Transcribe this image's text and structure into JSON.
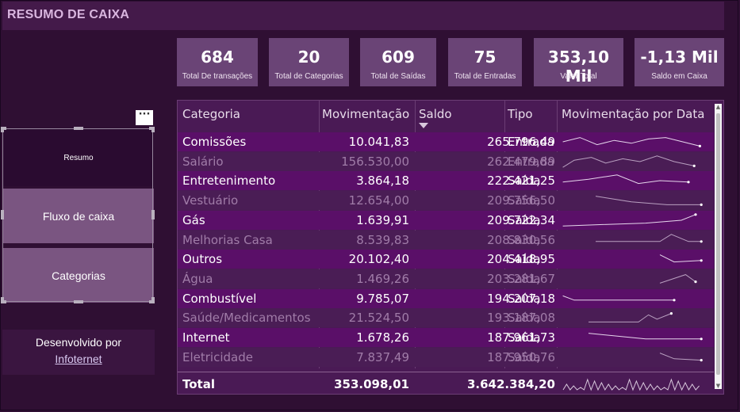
{
  "header": {
    "title": "RESUMO DE CAIXA"
  },
  "kpis": [
    {
      "value": "684",
      "label": "Total De transações"
    },
    {
      "value": "20",
      "label": "Total de Categorias"
    },
    {
      "value": "609",
      "label": "Total de Saídas"
    },
    {
      "value": "75",
      "label": "Total de Entradas"
    },
    {
      "value": "353,10 Mil",
      "label": "Valor Total"
    },
    {
      "value": "-1,13 Mil",
      "label": "Saldo em Caixa"
    }
  ],
  "nav": {
    "more_label": "···",
    "items": [
      {
        "label": "Resumo"
      },
      {
        "label": "Fluxo de caixa"
      },
      {
        "label": "Categorias"
      }
    ]
  },
  "developer": {
    "line1": "Desenvolvido por",
    "link": "Infoternet"
  },
  "table": {
    "headers": {
      "categoria": "Categoria",
      "movimentacao": "Movimentação",
      "saldo": "Saldo",
      "tipo": "Tipo",
      "por_data": "Movimentação por Data"
    },
    "rows": [
      {
        "categoria": "Comissões",
        "movimentacao": "10.041,83",
        "saldo": "265.796,49",
        "tipo": "Entrada"
      },
      {
        "categoria": "Salário",
        "movimentacao": "156.530,00",
        "saldo": "262.479,89",
        "tipo": "Entrada"
      },
      {
        "categoria": "Entretenimento",
        "movimentacao": "3.864,18",
        "saldo": "222.421,25",
        "tipo": "Saída"
      },
      {
        "categoria": "Vestuário",
        "movimentacao": "12.654,00",
        "saldo": "209.756,50",
        "tipo": "Saída"
      },
      {
        "categoria": "Gás",
        "movimentacao": "1.639,91",
        "saldo": "209.722,34",
        "tipo": "Saída"
      },
      {
        "categoria": "Melhorias Casa",
        "movimentacao": "8.539,83",
        "saldo": "208.830,56",
        "tipo": "Saída"
      },
      {
        "categoria": "Outros",
        "movimentacao": "20.102,40",
        "saldo": "204.418,95",
        "tipo": "Saída"
      },
      {
        "categoria": "Água",
        "movimentacao": "1.469,26",
        "saldo": "203.281,67",
        "tipo": "Saída"
      },
      {
        "categoria": "Combustível",
        "movimentacao": "9.785,07",
        "saldo": "194.207,18",
        "tipo": "Saída"
      },
      {
        "categoria": "Saúde/Medicamentos",
        "movimentacao": "21.524,50",
        "saldo": "193.187,08",
        "tipo": "Saída"
      },
      {
        "categoria": "Internet",
        "movimentacao": "1.678,26",
        "saldo": "187.961,73",
        "tipo": "Saída"
      },
      {
        "categoria": "Eletricidade",
        "movimentacao": "7.837,49",
        "saldo": "187.950,76",
        "tipo": "Saída"
      }
    ],
    "total": {
      "label": "Total",
      "movimentacao": "353.098,01",
      "saldo": "3.642.384,20"
    }
  },
  "colors": {
    "background": "#2f0f33",
    "card": "#6a4476",
    "row_highlight": "#5a0f68",
    "row_alt": "#4a1d55"
  }
}
